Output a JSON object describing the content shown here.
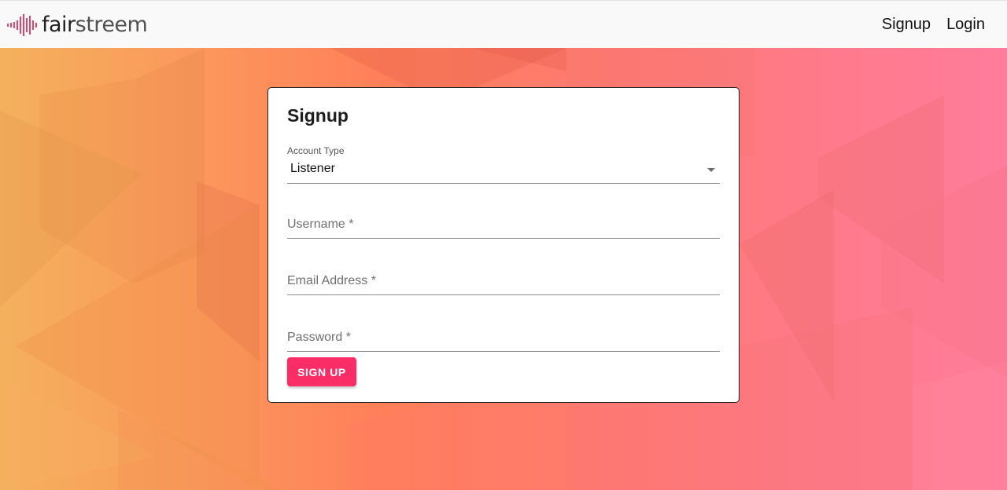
{
  "header": {
    "logo_text_part1": "fair",
    "logo_text_part2": "streem",
    "nav": {
      "signup": "Signup",
      "login": "Login"
    }
  },
  "form": {
    "title": "Signup",
    "account_type": {
      "label": "Account Type",
      "value": "Listener"
    },
    "username": {
      "label": "Username *",
      "value": ""
    },
    "email": {
      "label": "Email Address *",
      "value": ""
    },
    "password": {
      "label": "Password *",
      "value": ""
    },
    "submit_label": "SIGN UP"
  },
  "colors": {
    "brand": "#fb2d66",
    "logo_accent": "#e5456b",
    "background_start": "#f4b15c",
    "background_end": "#ff7c9c"
  }
}
